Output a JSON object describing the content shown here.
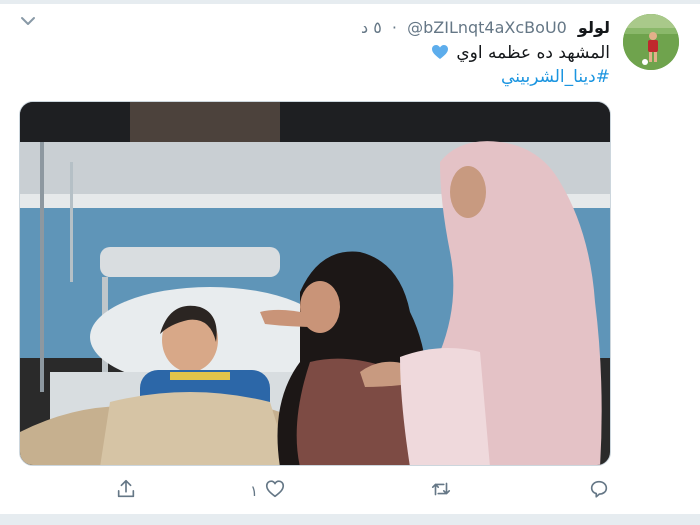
{
  "tweet": {
    "display_name": "لولو",
    "handle": "@bZILnqt4aXcBoU0",
    "separator": "·",
    "timestamp": "٥ د",
    "text": "المشهد ده عظمه اوي",
    "hashtag": "#دينا_الشربيني"
  },
  "actions": {
    "like_count": "١"
  },
  "colors": {
    "link": "#1b95e0",
    "muted": "#657786",
    "heart_emoji": "#5dadec"
  },
  "icons": {
    "menu": "chevron-down-icon",
    "reply": "reply-icon",
    "retweet": "retweet-icon",
    "like": "heart-icon",
    "share": "share-icon"
  }
}
